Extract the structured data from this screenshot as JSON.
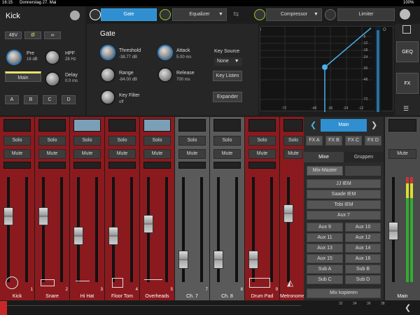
{
  "status": {
    "time": "16:15",
    "date": "Donnerstag 27. Mai",
    "battery": "100%"
  },
  "channel": {
    "name": "Kick",
    "phantom": "48V",
    "pre_label": "Pre",
    "pre_value": "16 dB",
    "hpf_label": "HPF",
    "hpf_value": "28 Hz",
    "delay_label": "Delay",
    "delay_value": "0.0 ms",
    "output": "Main",
    "buttons": [
      "A",
      "B",
      "C",
      "D"
    ]
  },
  "tabs": {
    "gate": "Gate",
    "equalizer": "Equalizer",
    "compressor": "Compressor",
    "limiter": "Limiter"
  },
  "gate": {
    "title": "Gate",
    "threshold_label": "Threshold",
    "threshold_value": "-38.77 dB",
    "attack_label": "Attack",
    "attack_value": "5.00 ms",
    "range_label": "Range",
    "range_value": "-84.00 dB",
    "release_label": "Release",
    "release_value": "700 ms",
    "keyfilter_label": "Key Filter",
    "keyfilter_value": "off",
    "keysource_label": "Key Source",
    "keysource_value": "None",
    "keylisten": "Key Listen",
    "expander": "Expander"
  },
  "graph": {
    "y_ticks": [
      "I",
      "-6",
      "-12",
      "-18",
      "-24",
      "-36",
      "-48",
      "-72"
    ],
    "x_ticks": [
      "-72",
      "-48",
      "-36",
      "-24",
      "-12"
    ],
    "o_label": "O"
  },
  "rightnav": {
    "geq": "GEQ",
    "fx": "FX"
  },
  "strip_buttons": {
    "solo": "Solo",
    "mute": "Mute"
  },
  "channels": [
    {
      "name": "Kick",
      "num": "1",
      "color": "red"
    },
    {
      "name": "Snare",
      "num": "2",
      "color": "red"
    },
    {
      "name": "Hi Hat",
      "num": "3",
      "color": "red"
    },
    {
      "name": "Floor Tom",
      "num": "4",
      "color": "red"
    },
    {
      "name": "Overheads",
      "num": "5",
      "color": "red"
    },
    {
      "name": "Ch. 7",
      "num": "7",
      "color": "gray"
    },
    {
      "name": "Ch. 8",
      "num": "8",
      "color": "gray"
    },
    {
      "name": "Drum Pad",
      "num": "9",
      "color": "red"
    },
    {
      "name": "Metronome",
      "num": "",
      "color": "red"
    }
  ],
  "mix": {
    "main": "Main",
    "fx": [
      "FX A",
      "FX B",
      "FX C",
      "FX D"
    ],
    "tab_mixes": "Mixe",
    "tab_groups": "Gruppen",
    "mix_master": "Mix-Master",
    "mix_copy": "Mix kopieren",
    "list": [
      "JJ IEM",
      "Saade IEM",
      "Tobi IEM",
      "Aux 7"
    ],
    "aux_pairs": [
      [
        "Aux 9",
        "Aux 10"
      ],
      [
        "Aux 11",
        "Aux 12"
      ],
      [
        "Aux 13",
        "Aux 14"
      ],
      [
        "Aux 15",
        "Aux 16"
      ],
      [
        "Sub A",
        "Sub B"
      ],
      [
        "Sub C",
        "Sub D"
      ]
    ]
  },
  "main_strip": {
    "mute": "Mute",
    "name": "Main"
  },
  "ruler": [
    "32",
    "34",
    "36",
    "38"
  ]
}
